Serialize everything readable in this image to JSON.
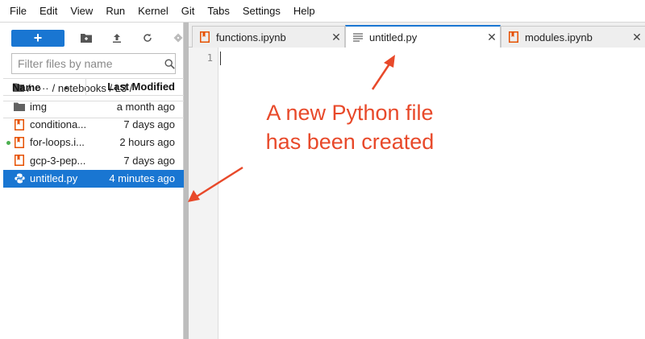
{
  "menu": [
    "File",
    "Edit",
    "View",
    "Run",
    "Kernel",
    "Git",
    "Tabs",
    "Settings",
    "Help"
  ],
  "toolbar": {
    "new_label": "+",
    "icons": [
      "new-folder-icon",
      "upload-icon",
      "refresh-icon",
      "git-clone-icon"
    ]
  },
  "filter": {
    "placeholder": "Filter files by name"
  },
  "breadcrumb": {
    "root": "/",
    "ellipsis": "···",
    "path": "/ notebooks / L3 /"
  },
  "file_browser": {
    "col_name": "Name",
    "col_modified": "Last Modified",
    "files": [
      {
        "name": "img",
        "modified": "a month ago",
        "type": "folder"
      },
      {
        "name": "conditiona...",
        "modified": "7 days ago",
        "type": "notebook"
      },
      {
        "name": "for-loops.i...",
        "modified": "2 hours ago",
        "type": "notebook",
        "running": true
      },
      {
        "name": "gcp-3-pep...",
        "modified": "7 days ago",
        "type": "notebook"
      },
      {
        "name": "untitled.py",
        "modified": "4 minutes ago",
        "type": "python",
        "selected": true
      }
    ]
  },
  "tabs": [
    {
      "label": "functions.ipynb",
      "type": "notebook"
    },
    {
      "label": "untitled.py",
      "type": "text",
      "active": true
    },
    {
      "label": "modules.ipynb",
      "type": "notebook"
    }
  ],
  "close_glyph": "✕",
  "editor": {
    "line_number": "1"
  },
  "annotation": {
    "line1": "A new Python file",
    "line2": "has been created"
  },
  "colors": {
    "accent": "#1976d2",
    "annotation": "#e8492a",
    "notebook_icon": "#e65100",
    "running": "#4caf50"
  }
}
